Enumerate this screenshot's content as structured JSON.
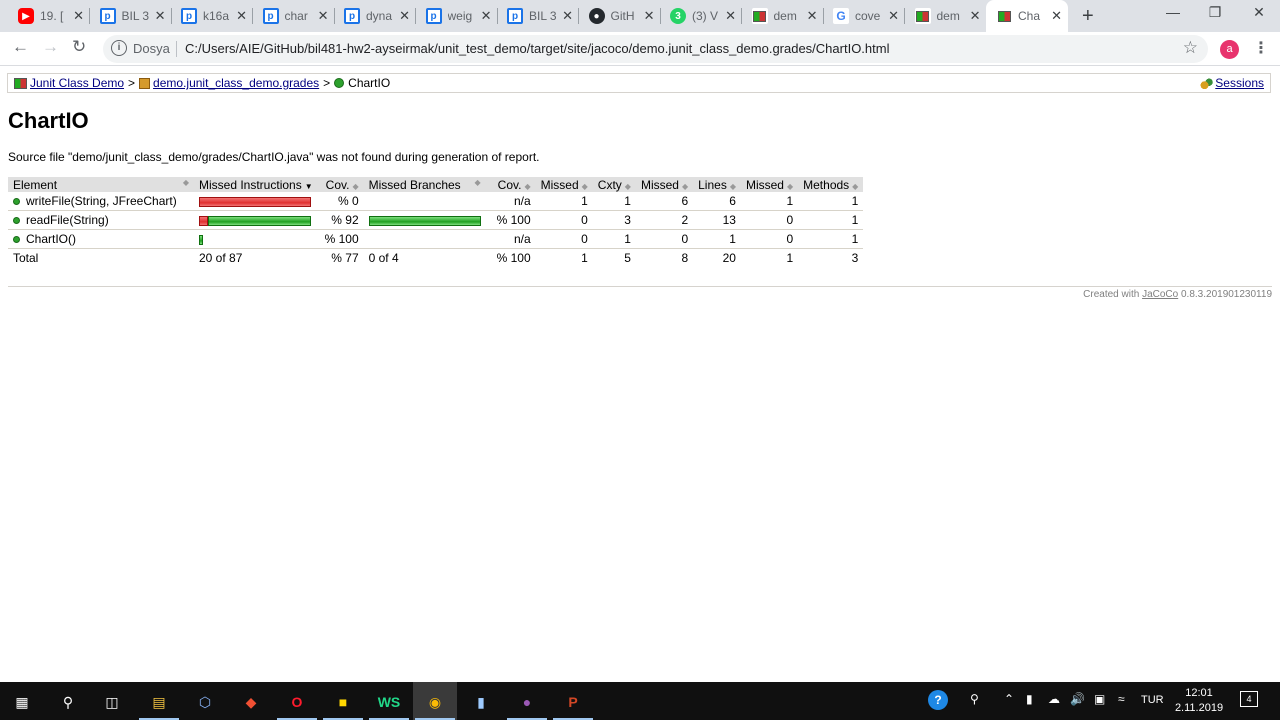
{
  "browser": {
    "tabs": [
      {
        "favicon": "youtube-icon",
        "title": "19. [",
        "active": false
      },
      {
        "favicon": "p-icon",
        "title": "BIL 3",
        "active": false
      },
      {
        "favicon": "p-icon",
        "title": "k16a",
        "active": false
      },
      {
        "favicon": "p-icon",
        "title": "char",
        "active": false
      },
      {
        "favicon": "p-icon",
        "title": "dyna",
        "active": false
      },
      {
        "favicon": "p-icon",
        "title": "weig",
        "active": false
      },
      {
        "favicon": "p-icon",
        "title": "BIL 3",
        "active": false
      },
      {
        "favicon": "github-icon",
        "title": "GitH",
        "active": false
      },
      {
        "favicon": "whatsapp-icon",
        "title": "(3) V",
        "active": false
      },
      {
        "favicon": "jacoco-icon",
        "title": "dem",
        "active": false
      },
      {
        "favicon": "google-icon",
        "title": "cove",
        "active": false
      },
      {
        "favicon": "jacoco-icon",
        "title": "dem",
        "active": false
      },
      {
        "favicon": "jacoco-icon",
        "title": "Cha",
        "active": true
      }
    ],
    "whatsapp_badge": "3",
    "omnibox": {
      "scheme_label": "Dosya",
      "url": "C:/Users/AIE/GitHub/bil481-hw2-ayseirmak/unit_test_demo/target/site/jacoco/demo.junit_class_demo.grades/ChartIO.html"
    },
    "profile_initial": "a"
  },
  "breadcrumb": {
    "items": [
      {
        "label": "Junit Class Demo",
        "icon": "report-icon"
      },
      {
        "label": "demo.junit_class_demo.grades",
        "icon": "package-icon"
      }
    ],
    "current": "ChartIO",
    "separator": ">",
    "sessions_label": "Sessions"
  },
  "page": {
    "title": "ChartIO",
    "source_message": "Source file \"demo/junit_class_demo/grades/ChartIO.java\" was not found during generation of report."
  },
  "table": {
    "headers": [
      "Element",
      "Missed Instructions",
      "Cov.",
      "Missed Branches",
      "Cov.",
      "Missed",
      "Cxty",
      "Missed",
      "Lines",
      "Missed",
      "Methods"
    ],
    "sorted_column": 1,
    "rows": [
      {
        "element": "writeFile(String, JFreeChart)",
        "instr_missed_fraction": 1.0,
        "instr_covered_fraction": 0.0,
        "instr_cov": "% 0",
        "branch_missed_fraction": 0,
        "branch_covered_fraction": 0,
        "branch_cov": "n/a",
        "cxty_missed": "1",
        "cxty": "1",
        "lines_missed": "6",
        "lines": "6",
        "methods_missed": "1",
        "methods": "1"
      },
      {
        "element": "readFile(String)",
        "instr_missed_fraction": 0.08,
        "instr_covered_fraction": 0.92,
        "instr_cov": "% 92",
        "branch_missed_fraction": 0,
        "branch_covered_fraction": 1.0,
        "branch_cov": "% 100",
        "cxty_missed": "0",
        "cxty": "3",
        "lines_missed": "2",
        "lines": "13",
        "methods_missed": "0",
        "methods": "1"
      },
      {
        "element": "ChartIO()",
        "instr_missed_fraction": 0,
        "instr_covered_fraction": 0.04,
        "instr_cov": "% 100",
        "branch_missed_fraction": 0,
        "branch_covered_fraction": 0,
        "branch_cov": "n/a",
        "cxty_missed": "0",
        "cxty": "1",
        "lines_missed": "0",
        "lines": "1",
        "methods_missed": "0",
        "methods": "1"
      }
    ],
    "total": {
      "label": "Total",
      "instructions": "20 of 87",
      "instr_cov": "% 77",
      "branches": "0 of 4",
      "branch_cov": "% 100",
      "cxty_missed": "1",
      "cxty": "5",
      "lines_missed": "8",
      "lines": "20",
      "methods_missed": "1",
      "methods": "3"
    }
  },
  "footer": {
    "prefix": "Created with",
    "link": "JaCoCo",
    "version": "0.8.3.201901230119"
  },
  "taskbar": {
    "apps": [
      "windows-start-icon",
      "search-icon",
      "task-view-icon",
      "file-explorer-icon",
      "virtualbox-icon",
      "git-icon",
      "opera-icon",
      "sticky-notes-icon",
      "webstorm-icon",
      "chrome-icon",
      "notepad-icon",
      "cat-app-icon",
      "powerpoint-icon"
    ],
    "language": "TUR",
    "time": "12:01",
    "date": "2.11.2019",
    "notification_count": "4"
  },
  "colors": {
    "bar_missed": "#e03030",
    "bar_covered": "#20a020",
    "link": "#000080",
    "header_bg": "#e0e0e0"
  }
}
